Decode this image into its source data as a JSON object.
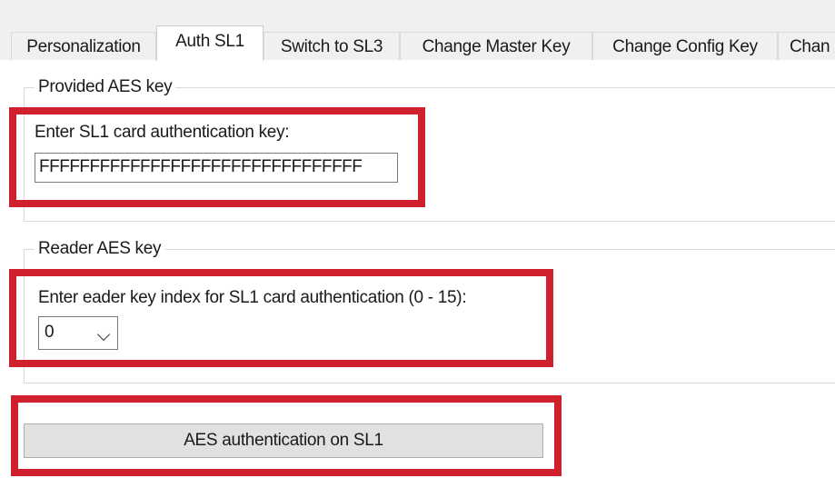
{
  "tabs": [
    {
      "label": "Personalization",
      "active": false
    },
    {
      "label": "Auth SL1",
      "active": true
    },
    {
      "label": "Switch to SL3",
      "active": false
    },
    {
      "label": "Change Master Key",
      "active": false
    },
    {
      "label": "Change Config Key",
      "active": false
    },
    {
      "label": "Chan",
      "active": false
    }
  ],
  "provided_group": {
    "title": "Provided AES key",
    "key_label": "Enter SL1 card authentication key:",
    "key_value": "FFFFFFFFFFFFFFFFFFFFFFFFFFFFFFFF"
  },
  "reader_group": {
    "title": "Reader AES key",
    "index_label": "Enter eader key index for SL1 card authentication (0 - 15):",
    "index_value": "0"
  },
  "auth_button_label": "AES authentication on SL1",
  "colors": {
    "highlight": "#d0202e",
    "button_face": "#e1e1e1",
    "tab_strip": "#f0f0f0"
  }
}
